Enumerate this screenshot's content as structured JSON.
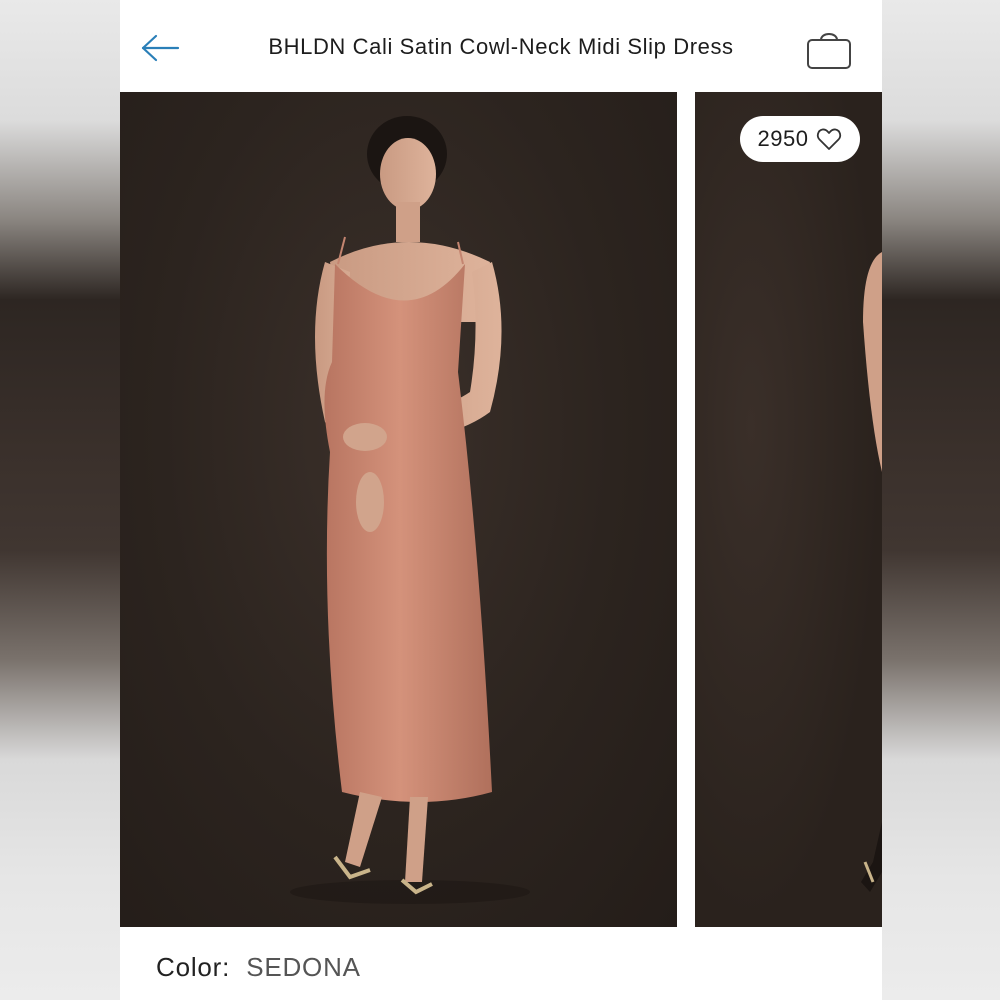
{
  "header": {
    "title": "BHLDN Cali Satin Cowl-Neck Midi Slip Dress",
    "back_icon": "arrow-left-icon",
    "bag_icon": "shopping-bag-icon"
  },
  "gallery": {
    "like_count": "2950",
    "like_icon": "heart-icon"
  },
  "product": {
    "color_label": "Color:",
    "color_value": "SEDONA"
  },
  "colors": {
    "accent": "#2a7fb8",
    "dress": "#c98670",
    "backdrop": "#2c241f"
  }
}
